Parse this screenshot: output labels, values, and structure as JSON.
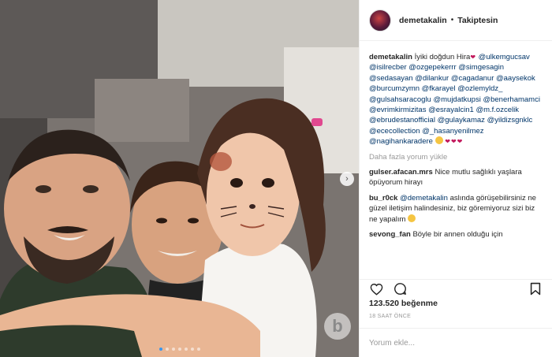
{
  "header": {
    "username": "demetakalin",
    "separator": "•",
    "follow_status": "Takiptesin"
  },
  "caption": {
    "username": "demetakalin",
    "text": "İyiki doğdun Hira",
    "mentions": [
      "@ulkemgucsav",
      "@isilrecber",
      "@ozgepekerrr",
      "@simgesagin",
      "@sedasayan",
      "@dilankur",
      "@cagadanur",
      "@aaysekok",
      "@burcumzymn",
      "@fkarayel",
      "@ozlemyldz_",
      "@gulsahsaracoglu",
      "@mujdatkupsi",
      "@benerhamamci",
      "@evrimkirmizitas",
      "@esrayalcin1",
      "@m.f.ozcelik",
      "@ebrudestanofficial",
      "@gulaykamaz",
      "@yildizsgnklc",
      "@ececollection",
      "@_hasanyenilmez",
      "@nagihankaradere"
    ]
  },
  "load_more": "Daha fazla yorum yükle",
  "comments": [
    {
      "username": "gulser.afacan.mrs",
      "text": "Nice mutlu sağlıklı yaşlara öpüyorum hirayı"
    },
    {
      "username": "bu_r0ck",
      "mention": "@demetakalin",
      "text": "aslında görüşebilirsiniz ne güzel iletişim halindesiniz, biz göremiyoruz sizi biz ne yapalım"
    },
    {
      "username": "sevong_fan",
      "text": "Böyle bir annen olduğu için"
    }
  ],
  "likes": "123.520 beğenme",
  "timestamp": "18 SAAT ÖNCE",
  "add_comment_placeholder": "Yorum ekle...",
  "icons": {
    "like": "heart-outline-icon",
    "comment": "speech-bubble-icon",
    "save": "bookmark-icon",
    "next": "chevron-right-icon"
  },
  "colors": {
    "text": "#262626",
    "mention": "#003569",
    "muted": "#999999",
    "divider": "#efefef",
    "active_dot": "#3897f0"
  }
}
